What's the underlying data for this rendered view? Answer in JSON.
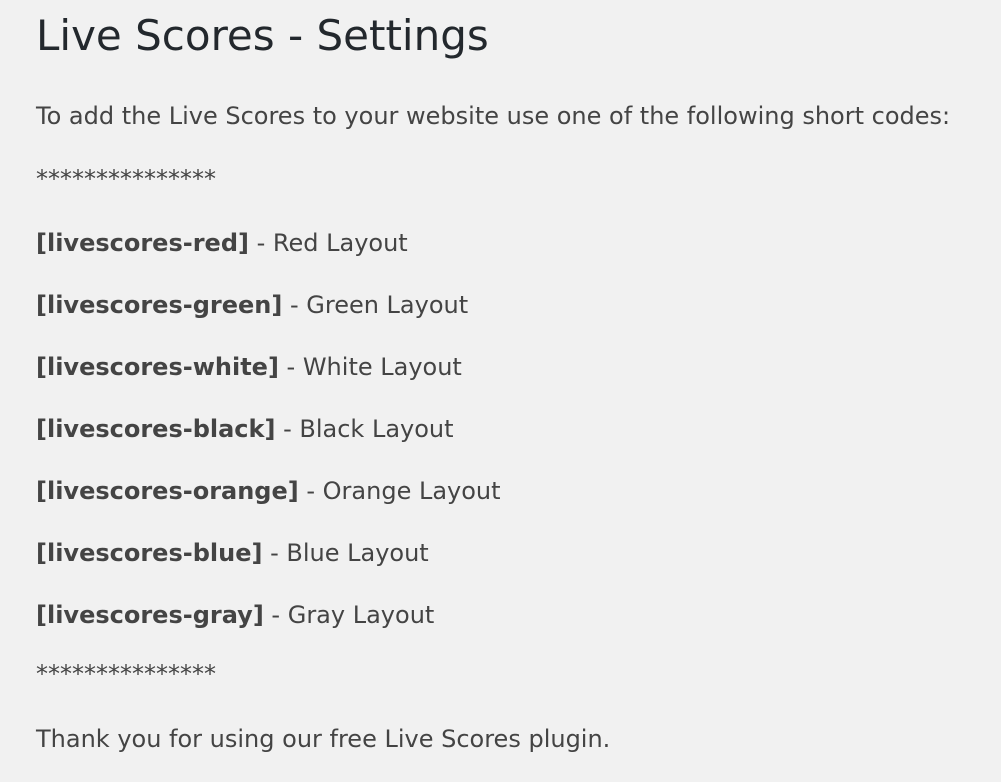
{
  "page": {
    "title": "Live Scores - Settings",
    "intro": "To add the Live Scores to your website use one of the following short codes:",
    "separator": "***************",
    "shortcodes": [
      {
        "code": "[livescores-red]",
        "separator": " - ",
        "description": "Red Layout"
      },
      {
        "code": "[livescores-green]",
        "separator": " - ",
        "description": "Green Layout"
      },
      {
        "code": "[livescores-white]",
        "separator": " - ",
        "description": "White Layout"
      },
      {
        "code": "[livescores-black]",
        "separator": " - ",
        "description": "Black Layout"
      },
      {
        "code": "[livescores-orange]",
        "separator": " - ",
        "description": "Orange Layout"
      },
      {
        "code": "[livescores-blue]",
        "separator": " - ",
        "description": "Blue Layout"
      },
      {
        "code": "[livescores-gray]",
        "separator": " - ",
        "description": "Gray Layout"
      }
    ],
    "thanks": "Thank you for using our free Live Scores plugin."
  },
  "colors": {
    "background": "#f1f1f1",
    "title": "#23282d",
    "text": "#444444"
  }
}
